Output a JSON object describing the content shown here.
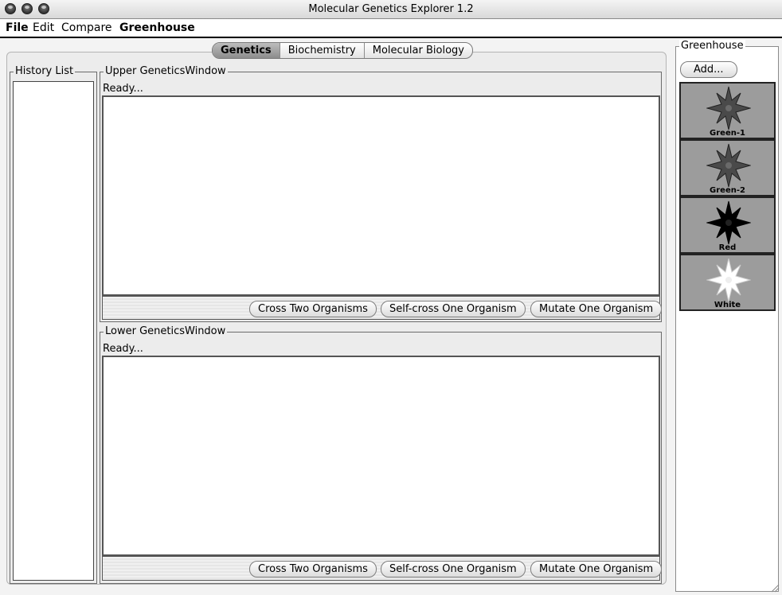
{
  "window": {
    "title": "Molecular Genetics Explorer 1.2"
  },
  "menu": {
    "file": "File",
    "edit": "Edit",
    "compare": "Compare",
    "greenhouse": "Greenhouse"
  },
  "tabs": [
    {
      "label": "Genetics",
      "active": true
    },
    {
      "label": "Biochemistry",
      "active": false
    },
    {
      "label": "Molecular Biology",
      "active": false
    }
  ],
  "history": {
    "label": "History List"
  },
  "upper": {
    "label": "Upper GeneticsWindow",
    "status": "Ready...",
    "buttons": {
      "cross": "Cross Two Organisms",
      "self": "Self-cross One Organism",
      "mutate": "Mutate One Organism"
    }
  },
  "lower": {
    "label": "Lower GeneticsWindow",
    "status": "Ready...",
    "buttons": {
      "cross": "Cross Two Organisms",
      "self": "Self-cross One Organism",
      "mutate": "Mutate One Organism"
    }
  },
  "greenhouse": {
    "label": "Greenhouse",
    "add_label": "Add...",
    "organisms": [
      {
        "name": "Green-1",
        "color": "#4a4a4a"
      },
      {
        "name": "Green-2",
        "color": "#4a4a4a"
      },
      {
        "name": "Red",
        "color": "#000000"
      },
      {
        "name": "White",
        "color": "#ffffff"
      }
    ]
  }
}
